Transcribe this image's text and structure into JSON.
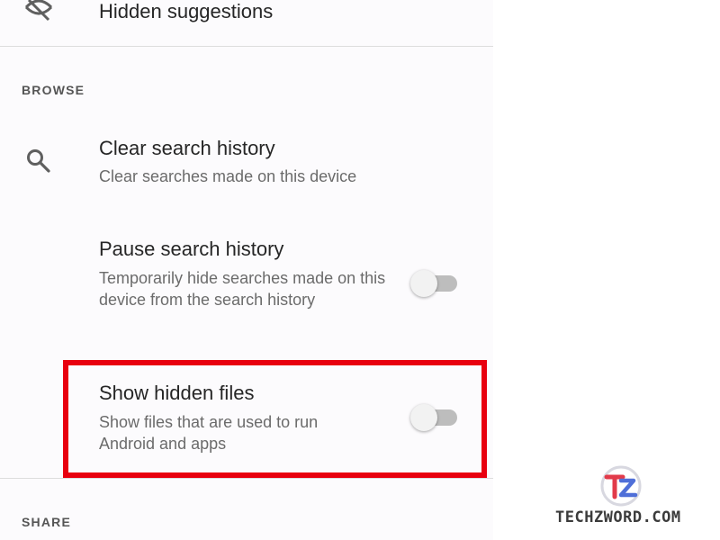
{
  "top_item": {
    "icon": "visibility-off-icon",
    "title": "Hidden suggestions"
  },
  "sections": {
    "browse": {
      "header": "BROWSE",
      "items": [
        {
          "icon": "search-icon",
          "title": "Clear search history",
          "subtitle": "Clear searches made on this device"
        },
        {
          "title": "Pause search history",
          "subtitle": "Temporarily hide searches made on this device from the search history",
          "toggle_on": false
        },
        {
          "title": "Show hidden files",
          "subtitle": "Show files that are used to run Android and apps",
          "toggle_on": false
        }
      ]
    },
    "share": {
      "header": "SHARE"
    }
  },
  "watermark": {
    "text": "TECHZWORD.COM"
  },
  "colors": {
    "highlight": "#e8000f",
    "title_text": "#262626",
    "subtitle_text": "#6b6b6b",
    "toggle_off_track": "#bdbdbd"
  }
}
